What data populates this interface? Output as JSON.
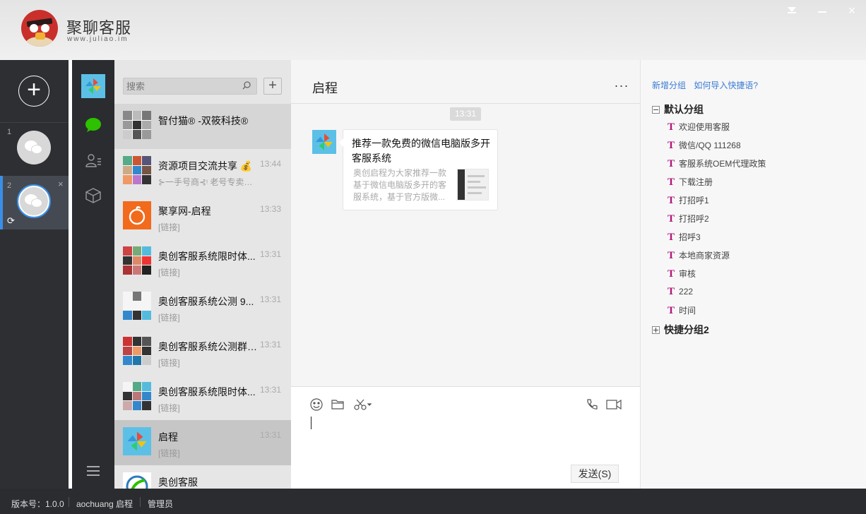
{
  "app": {
    "name": "聚聊客服",
    "url": "www.juliao.im"
  },
  "window_controls": {
    "dropdown": "dropdown-icon",
    "minimize": "minimize-icon",
    "close": "×"
  },
  "accounts": {
    "add": "+",
    "items": [
      {
        "num": "1"
      },
      {
        "num": "2",
        "close": "×",
        "sync": "⟳"
      }
    ]
  },
  "search": {
    "placeholder": "搜索",
    "add": "+"
  },
  "conversations": [
    {
      "name": "智付猫® -双筱科技®",
      "time": "",
      "preview": ""
    },
    {
      "name": "资源项目交流共享 💰",
      "time": "13:44",
      "preview": "⊱一手号商⊰ᵎ 老号专卖：..."
    },
    {
      "name": "聚享网-启程",
      "time": "13:33",
      "preview": "[链接]"
    },
    {
      "name": "奥创客服系统限时体...",
      "time": "13:31",
      "preview": "[链接]"
    },
    {
      "name": "奥创客服系统公测 9...",
      "time": "13:31",
      "preview": "[链接]"
    },
    {
      "name": "奥创客服系统公测群(...",
      "time": "13:31",
      "preview": "[链接]"
    },
    {
      "name": "奥创客服系统限时体...",
      "time": "13:31",
      "preview": "[链接]"
    },
    {
      "name": "启程",
      "time": "13:31",
      "preview": "[链接]"
    },
    {
      "name": "奥创客服",
      "time": "",
      "preview": ""
    }
  ],
  "chat": {
    "title": "启程",
    "more": "...",
    "timestamp": "13:31",
    "card": {
      "title": "推荐一款免费的微信电脑版多开客服系统",
      "desc": "奥创启程为大家推荐一款基于微信电脑版多开的客服系统，基于官方版微..."
    },
    "send": "发送(S)"
  },
  "quick": {
    "links": [
      "新增分组",
      "如何导入快捷语?"
    ],
    "groups": [
      {
        "name": "默认分组",
        "expanded": true,
        "items": [
          "欢迎使用客服",
          "微信/QQ 111268",
          "客服系统OEM代理政策",
          "下载注册",
          "打招呼1",
          "打招呼2",
          "招呼3",
          "本地商家资源",
          "审核",
          "222",
          "时间"
        ]
      },
      {
        "name": "快捷分组2",
        "expanded": false,
        "items": []
      }
    ]
  },
  "status": {
    "version": "版本号：1.0.0",
    "user": "aochuang 启程",
    "role": "管理员"
  },
  "colors": {
    "accent": "#3a8ee6",
    "wechat_green": "#2dc100",
    "quick_t": "#b0147a",
    "link": "#3a7bd5"
  }
}
